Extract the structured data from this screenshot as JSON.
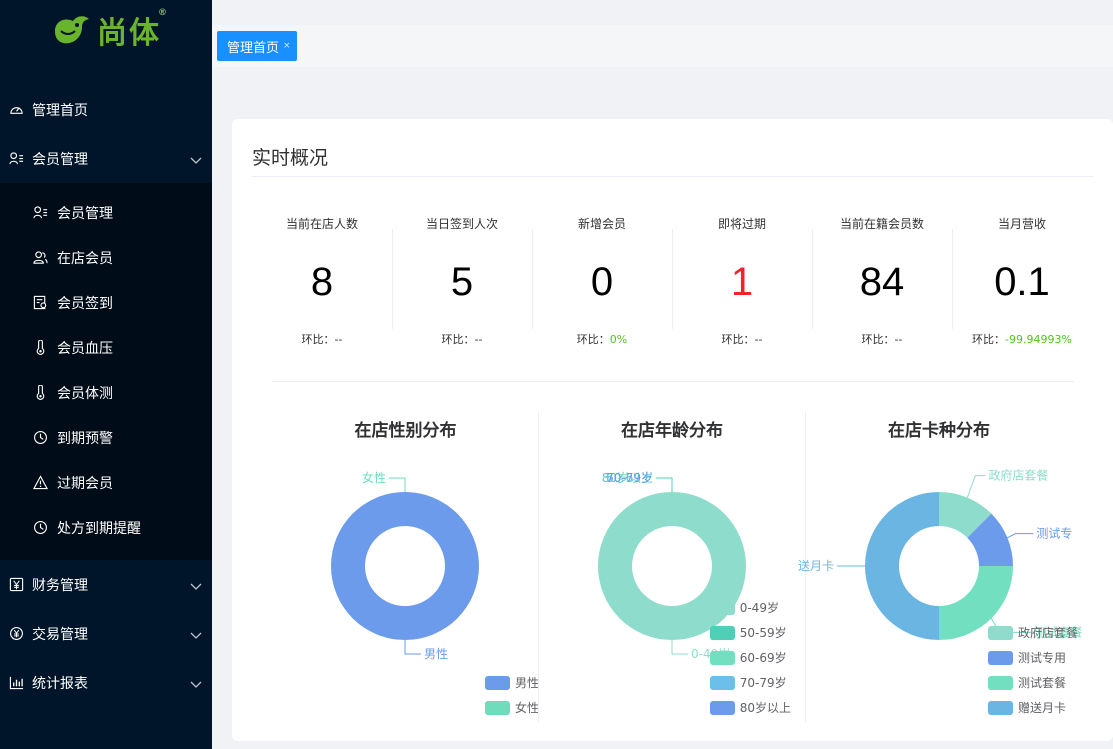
{
  "brand": {
    "name": "尚体",
    "registered": "®"
  },
  "sidebar": {
    "items": [
      {
        "label": "管理首页",
        "icon": "dashboard-icon"
      },
      {
        "label": "会员管理",
        "icon": "member-icon",
        "expanded": true,
        "children": [
          {
            "label": "会员管理",
            "icon": "member-list-icon"
          },
          {
            "label": "在店会员",
            "icon": "user-group-icon"
          },
          {
            "label": "会员签到",
            "icon": "checkin-icon"
          },
          {
            "label": "会员血压",
            "icon": "thermometer-icon"
          },
          {
            "label": "会员体测",
            "icon": "thermometer-icon"
          },
          {
            "label": "到期预警",
            "icon": "clock-icon"
          },
          {
            "label": "过期会员",
            "icon": "warning-icon"
          },
          {
            "label": "处方到期提醒",
            "icon": "clock-icon"
          }
        ]
      },
      {
        "label": "财务管理",
        "icon": "finance-icon"
      },
      {
        "label": "交易管理",
        "icon": "transaction-icon"
      },
      {
        "label": "统计报表",
        "icon": "chart-icon"
      }
    ]
  },
  "tabs": [
    {
      "label": "管理首页",
      "close": "×"
    }
  ],
  "overview": {
    "title": "实时概况",
    "compare_label": "环比：",
    "stats": [
      {
        "label": "当前在店人数",
        "value": "8",
        "compare": "--"
      },
      {
        "label": "当日签到人次",
        "value": "5",
        "compare": "--"
      },
      {
        "label": "新增会员",
        "value": "0",
        "compare": "0%"
      },
      {
        "label": "即将过期",
        "value": "1",
        "compare": "--"
      },
      {
        "label": "当前在籍会员数",
        "value": "84",
        "compare": "--"
      },
      {
        "label": "当月营收",
        "value": "0.1",
        "compare": "-99.94993%"
      }
    ]
  },
  "colors": {
    "accent": "#1890ff",
    "sidebar_bg": "#001529",
    "alert_red": "#f5222d",
    "positive_green": "#52c41a"
  },
  "chart_data": [
    {
      "type": "pie",
      "title": "在店性别分布",
      "categories": [
        "男性",
        "女性"
      ],
      "values": [
        8,
        0
      ],
      "colors": [
        "#6b9bea",
        "#6fdcbc"
      ],
      "legend_position": "bottom-right"
    },
    {
      "type": "pie",
      "title": "在店年龄分布",
      "categories": [
        "0-49岁",
        "50-59岁",
        "60-69岁",
        "70-79岁",
        "80岁以上"
      ],
      "values": [
        8,
        0,
        0,
        0,
        0
      ],
      "colors": [
        "#8edccb",
        "#4fd0b6",
        "#71dfc0",
        "#6bbfe8",
        "#6b9bea"
      ],
      "callout_labels": [
        "0-49岁",
        "80岁以上",
        "50-59岁",
        "60-69岁",
        "70-79岁"
      ],
      "legend_position": "bottom-right"
    },
    {
      "type": "pie",
      "title": "在店卡种分布",
      "categories": [
        "政府店套餐",
        "测试专用",
        "测试套餐",
        "赠送月卡"
      ],
      "values": [
        1,
        1,
        2,
        4
      ],
      "colors": [
        "#8edccb",
        "#6b9bea",
        "#71dfc0",
        "#6bb5e3"
      ],
      "callout_labels": [
        "政府店套餐",
        "测试专",
        "测试套餐",
        "送月卡"
      ],
      "legend_position": "bottom-right"
    }
  ]
}
